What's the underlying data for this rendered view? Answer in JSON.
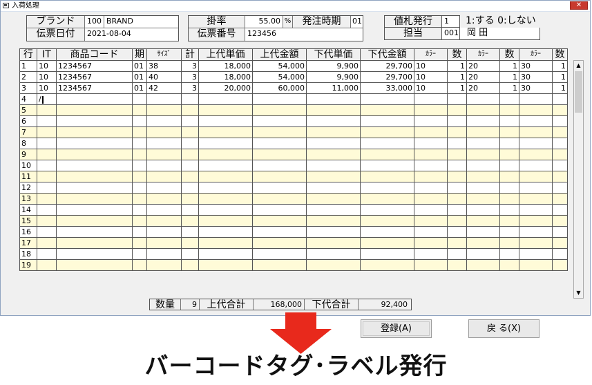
{
  "window": {
    "title": "入荷処理",
    "close_glyph": "✕",
    "app_icon": "app-window-icon"
  },
  "header": {
    "brand_label": "ブランド",
    "brand_code": "100",
    "brand_name": "BRAND",
    "slip_date_label": "伝票日付",
    "slip_date": "2021-08-04",
    "rate_label": "掛率",
    "rate_value": "55.00",
    "rate_unit": "%",
    "order_period_label": "発注時期",
    "order_period": "01",
    "slip_no_label": "伝票番号",
    "slip_no": "123456",
    "price_tag_label": "値札発行",
    "price_tag_value": "1",
    "price_tag_hint": "1:する 0:しない",
    "staff_label": "担当",
    "staff_code": "001",
    "staff_name": "岡 田"
  },
  "table": {
    "columns": [
      "行",
      "IT",
      "商品コード",
      "期",
      "ｻｲｽﾞ",
      "計",
      "上代単価",
      "上代金額",
      "下代単価",
      "下代金額",
      "ｶﾗｰ",
      "数",
      "ｶﾗｰ",
      "数",
      "ｶﾗｰ",
      "数"
    ],
    "rows": [
      [
        "1",
        "10",
        "1234567",
        "01",
        "38",
        "3",
        "18,000",
        "54,000",
        "9,900",
        "29,700",
        "10",
        "1",
        "20",
        "1",
        "30",
        "1"
      ],
      [
        "2",
        "10",
        "1234567",
        "01",
        "40",
        "3",
        "18,000",
        "54,000",
        "9,900",
        "29,700",
        "10",
        "1",
        "20",
        "1",
        "30",
        "1"
      ],
      [
        "3",
        "10",
        "1234567",
        "01",
        "42",
        "3",
        "20,000",
        "60,000",
        "11,000",
        "33,000",
        "10",
        "1",
        "20",
        "1",
        "30",
        "1"
      ],
      [
        "4",
        "/",
        "",
        "",
        "",
        "",
        "",
        "",
        "",
        "",
        "",
        "",
        "",
        "",
        "",
        ""
      ],
      [
        "5",
        "",
        "",
        "",
        "",
        "",
        "",
        "",
        "",
        "",
        "",
        "",
        "",
        "",
        "",
        ""
      ],
      [
        "6",
        "",
        "",
        "",
        "",
        "",
        "",
        "",
        "",
        "",
        "",
        "",
        "",
        "",
        "",
        ""
      ],
      [
        "7",
        "",
        "",
        "",
        "",
        "",
        "",
        "",
        "",
        "",
        "",
        "",
        "",
        "",
        "",
        ""
      ],
      [
        "8",
        "",
        "",
        "",
        "",
        "",
        "",
        "",
        "",
        "",
        "",
        "",
        "",
        "",
        "",
        ""
      ],
      [
        "9",
        "",
        "",
        "",
        "",
        "",
        "",
        "",
        "",
        "",
        "",
        "",
        "",
        "",
        "",
        ""
      ],
      [
        "10",
        "",
        "",
        "",
        "",
        "",
        "",
        "",
        "",
        "",
        "",
        "",
        "",
        "",
        "",
        ""
      ],
      [
        "11",
        "",
        "",
        "",
        "",
        "",
        "",
        "",
        "",
        "",
        "",
        "",
        "",
        "",
        "",
        ""
      ],
      [
        "12",
        "",
        "",
        "",
        "",
        "",
        "",
        "",
        "",
        "",
        "",
        "",
        "",
        "",
        "",
        ""
      ],
      [
        "13",
        "",
        "",
        "",
        "",
        "",
        "",
        "",
        "",
        "",
        "",
        "",
        "",
        "",
        "",
        ""
      ],
      [
        "14",
        "",
        "",
        "",
        "",
        "",
        "",
        "",
        "",
        "",
        "",
        "",
        "",
        "",
        "",
        ""
      ],
      [
        "15",
        "",
        "",
        "",
        "",
        "",
        "",
        "",
        "",
        "",
        "",
        "",
        "",
        "",
        "",
        ""
      ],
      [
        "16",
        "",
        "",
        "",
        "",
        "",
        "",
        "",
        "",
        "",
        "",
        "",
        "",
        "",
        "",
        ""
      ],
      [
        "17",
        "",
        "",
        "",
        "",
        "",
        "",
        "",
        "",
        "",
        "",
        "",
        "",
        "",
        "",
        ""
      ],
      [
        "18",
        "",
        "",
        "",
        "",
        "",
        "",
        "",
        "",
        "",
        "",
        "",
        "",
        "",
        "",
        ""
      ],
      [
        "19",
        "",
        "",
        "",
        "",
        "",
        "",
        "",
        "",
        "",
        "",
        "",
        "",
        "",
        "",
        ""
      ]
    ]
  },
  "totals": {
    "qty_label": "数量",
    "qty_value": "9",
    "retail_total_label": "上代合計",
    "retail_total_value": "168,000",
    "wholesale_total_label": "下代合計",
    "wholesale_total_value": "92,400"
  },
  "buttons": {
    "register": "登録(A)",
    "back": "戻 る(X)"
  },
  "scrollbar": {
    "up_glyph": "▲",
    "down_glyph": "▼"
  },
  "caption": "バーコードタグ･ラベル発行",
  "colors": {
    "accent_arrow": "#e8291c",
    "row_alt": "#fffbd8",
    "close": "#c83a2f"
  }
}
